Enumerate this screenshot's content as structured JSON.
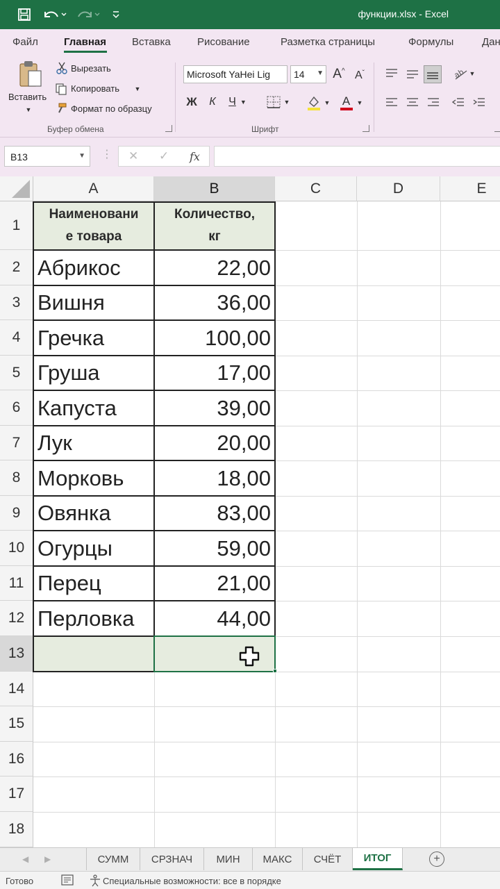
{
  "window": {
    "title": "функции.xlsx  -  Excel"
  },
  "ribbon": {
    "tabs": [
      "Файл",
      "Главная",
      "Вставка",
      "Рисование",
      "Разметка страницы",
      "Формулы",
      "Дан"
    ],
    "active_tab": "Главная",
    "clipboard": {
      "paste": "Вставить",
      "cut": "Вырезать",
      "copy": "Копировать",
      "format_painter": "Формат по образцу",
      "group_label": "Буфер обмена"
    },
    "font": {
      "family": "Microsoft YaHei Lig",
      "size": "14",
      "bold": "Ж",
      "italic": "К",
      "underline": "Ч",
      "grow": "A",
      "shrink": "A",
      "font_color_letter": "A",
      "group_label": "Шрифт",
      "highlight_color": "#f5e23a",
      "font_color": "#d0021b"
    }
  },
  "formula_bar": {
    "name_box": "B13",
    "cancel": "✕",
    "enter": "✓",
    "fx": "fx",
    "value": ""
  },
  "grid": {
    "columns": [
      "A",
      "B",
      "C",
      "D",
      "E"
    ],
    "selected_column": "B",
    "rows": [
      "1",
      "2",
      "3",
      "4",
      "5",
      "6",
      "7",
      "8",
      "9",
      "10",
      "11",
      "12",
      "13",
      "14",
      "15",
      "16",
      "17",
      "18"
    ],
    "selected_row": "13",
    "header": {
      "name_line1": "Наименовани",
      "name_line2": "е товара",
      "qty_line1": "Количество,",
      "qty_line2": "кг"
    },
    "data": [
      {
        "name": "Абрикос",
        "qty": "22,00"
      },
      {
        "name": "Вишня",
        "qty": "36,00"
      },
      {
        "name": "Гречка",
        "qty": "100,00"
      },
      {
        "name": "Груша",
        "qty": "17,00"
      },
      {
        "name": "Капуста",
        "qty": "39,00"
      },
      {
        "name": "Лук",
        "qty": "20,00"
      },
      {
        "name": "Морковь",
        "qty": "18,00"
      },
      {
        "name": "Овянка",
        "qty": "83,00"
      },
      {
        "name": "Огурцы",
        "qty": "59,00"
      },
      {
        "name": "Перец",
        "qty": "21,00"
      },
      {
        "name": "Перловка",
        "qty": "44,00"
      }
    ],
    "active_cell": "B13",
    "accent_color": "#1e7145"
  },
  "sheets": {
    "tabs": [
      "СУММ",
      "СРЗНАЧ",
      "МИН",
      "МАКС",
      "СЧЁТ",
      "ИТОГ"
    ],
    "active": "ИТОГ",
    "add": "+"
  },
  "status": {
    "ready": "Готово",
    "accessibility": "Специальные возможности: все в порядке"
  }
}
